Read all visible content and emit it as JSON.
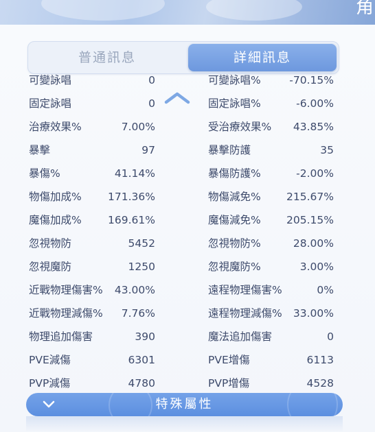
{
  "header": {
    "corner_char": "角"
  },
  "tabs": {
    "basic_label": "普通訊息",
    "detail_label": "詳細訊息"
  },
  "rows": [
    {
      "l_label": "可變詠唱",
      "l_value": "0",
      "r_label": "可變詠唱%",
      "r_value": "-70.15%"
    },
    {
      "l_label": "固定詠唱",
      "l_value": "0",
      "r_label": "固定詠唱%",
      "r_value": "-6.00%"
    },
    {
      "l_label": "治療效果%",
      "l_value": "7.00%",
      "r_label": "受治療效果%",
      "r_value": "43.85%"
    },
    {
      "l_label": "暴擊",
      "l_value": "97",
      "r_label": "暴擊防護",
      "r_value": "35"
    },
    {
      "l_label": "暴傷%",
      "l_value": "41.14%",
      "r_label": "暴傷防護%",
      "r_value": "-2.00%"
    },
    {
      "l_label": "物傷加成%",
      "l_value": "171.36%",
      "r_label": "物傷減免%",
      "r_value": "215.67%"
    },
    {
      "l_label": "魔傷加成%",
      "l_value": "169.61%",
      "r_label": "魔傷減免%",
      "r_value": "205.15%"
    },
    {
      "l_label": "忽視物防",
      "l_value": "5452",
      "r_label": "忽視物防%",
      "r_value": "28.00%"
    },
    {
      "l_label": "忽視魔防",
      "l_value": "1250",
      "r_label": "忽視魔防%",
      "r_value": "3.00%"
    },
    {
      "l_label": "近戰物理傷害%",
      "l_value": "43.00%",
      "r_label": "遠程物理傷害%",
      "r_value": "0%"
    },
    {
      "l_label": "近戰物理減傷%",
      "l_value": "7.76%",
      "r_label": "遠程物理減傷%",
      "r_value": "33.00%"
    },
    {
      "l_label": "物理追加傷害",
      "l_value": "390",
      "r_label": "魔法追加傷害",
      "r_value": "0"
    },
    {
      "l_label": "PVE減傷",
      "l_value": "6301",
      "r_label": "PVE增傷",
      "r_value": "6113"
    },
    {
      "l_label": "PVP減傷",
      "l_value": "4780",
      "r_label": "PVP增傷",
      "r_value": "4528"
    }
  ],
  "bottom": {
    "label": "特殊屬性"
  },
  "icons": {
    "scroll_up": "chevron-up-icon",
    "expand": "chevron-down-icon"
  },
  "colors": {
    "accent": "#6d98de",
    "text": "#3d4a6b",
    "tab_inactive": "#9aa7bd"
  }
}
